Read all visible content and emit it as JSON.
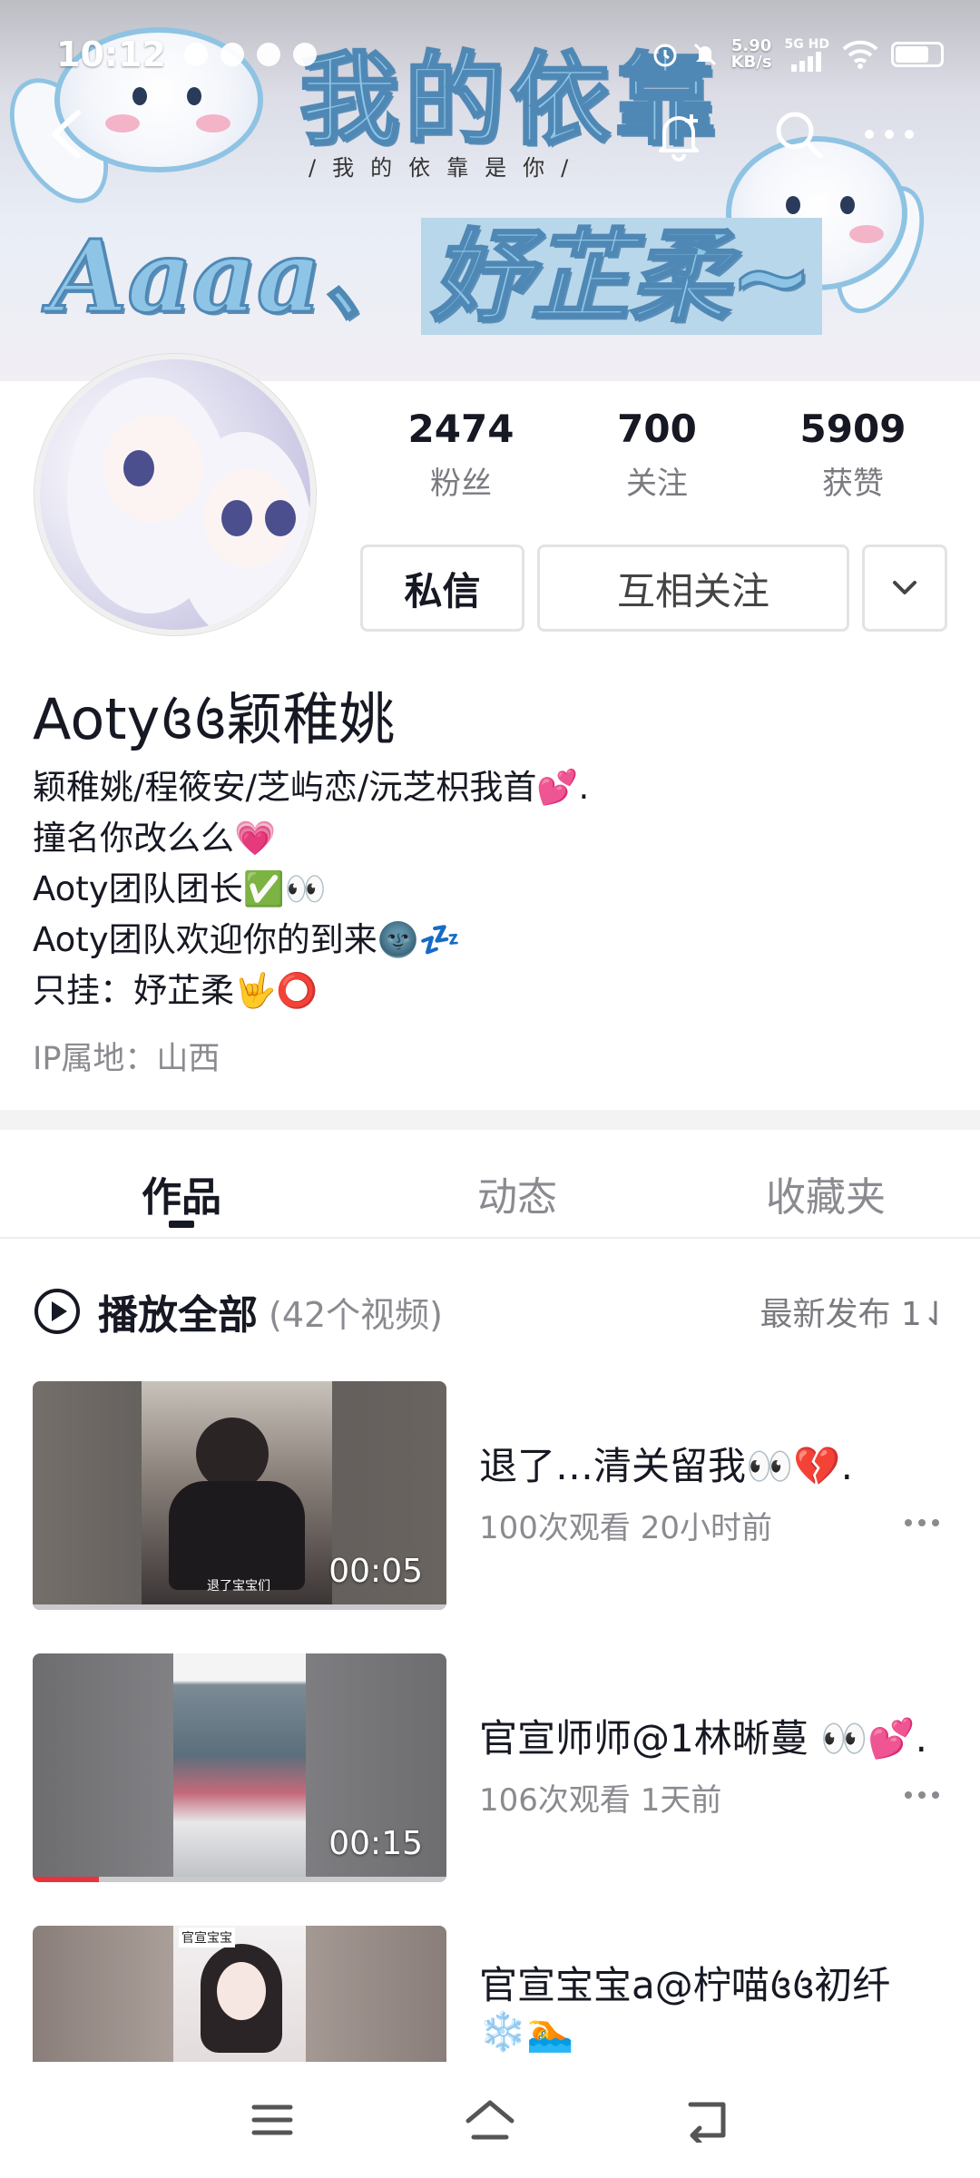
{
  "status_bar": {
    "time": "10:12",
    "net_speed_value": "5.90",
    "net_speed_unit": "KB/s",
    "network": "5G HD"
  },
  "banner": {
    "title": "我的依靠",
    "subtitle": "/我的依靠是你/",
    "name_prefix": "Aaaa、",
    "name_highlight": "妤芷柔~"
  },
  "profile": {
    "stats": [
      {
        "value": "2474",
        "label": "粉丝"
      },
      {
        "value": "700",
        "label": "关注"
      },
      {
        "value": "5909",
        "label": "获赞"
      }
    ],
    "message_button": "私信",
    "follow_button": "互相关注",
    "username": "Aoty꧔꧔颖稚姚",
    "bio": [
      "颖稚姚/程筱安/芝屿恋/沅芝枳我首💕.",
      "撞名你改么么💗",
      "Aoty团队团长✅👀",
      "Aoty团队欢迎你的到来🌚💤",
      "只挂：妤芷柔🤟⭕"
    ],
    "ip_location": "IP属地：山西"
  },
  "tabs": [
    {
      "label": "作品",
      "active": true
    },
    {
      "label": "动态",
      "active": false
    },
    {
      "label": "收藏夹",
      "active": false
    }
  ],
  "play_all": {
    "label": "播放全部",
    "count": "(42个视频)",
    "sort": "最新发布 1⇃"
  },
  "videos": [
    {
      "title": "退了…清关留我👀💔.",
      "views": "100次观看",
      "time": "20小时前",
      "duration": "00:05",
      "thumb_caption": "退了宝宝们",
      "progress": 0
    },
    {
      "title": "官宣师师@1林晰蔓 👀💕.",
      "views": "106次观看",
      "time": "1天前",
      "duration": "00:15",
      "progress": 0.16
    },
    {
      "title": "官宣宝宝a@柠喵꧔꧔初纤",
      "title_line2": "❄️🏊",
      "thumb_caption": "官宣宝宝"
    }
  ],
  "icons": {
    "back": "back-arrow-icon",
    "bell": "bell-plus-icon",
    "search": "search-icon",
    "more": "more-icon"
  },
  "colors": {
    "text_primary": "#161823",
    "text_secondary": "#8a8a90",
    "progress": "#e8323c"
  }
}
